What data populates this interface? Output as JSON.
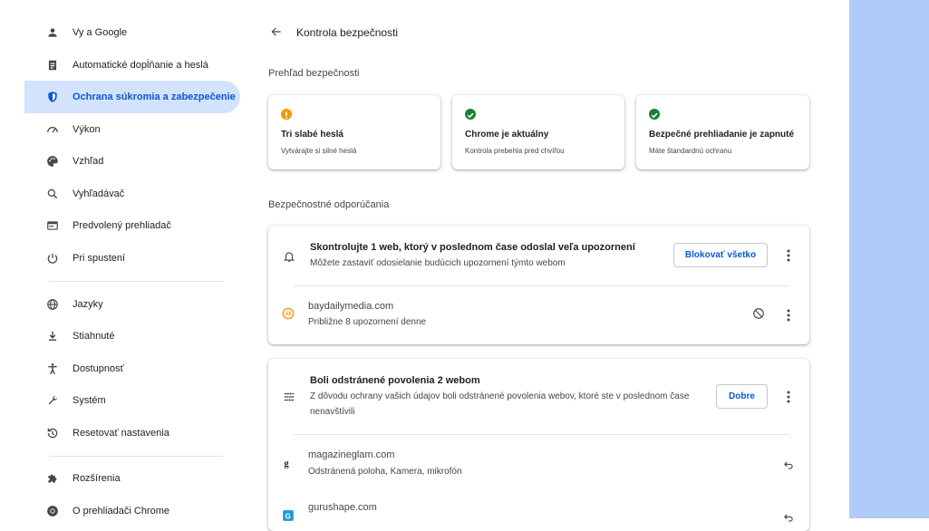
{
  "sidebar": {
    "items": [
      {
        "label": "Vy a Google",
        "icon": "person-icon"
      },
      {
        "label": "Automatické dopĺňanie a heslá",
        "icon": "clipboard-icon"
      },
      {
        "label": "Ochrana súkromia a zabezpečenie",
        "icon": "shield-icon",
        "active": true
      },
      {
        "label": "Výkon",
        "icon": "speedometer-icon"
      },
      {
        "label": "Vzhľad",
        "icon": "palette-icon"
      },
      {
        "label": "Vyhľadávač",
        "icon": "search-icon"
      },
      {
        "label": "Predvolený prehliadač",
        "icon": "browser-icon"
      },
      {
        "label": "Pri spustení",
        "icon": "power-icon"
      },
      {
        "label": "Jazyky",
        "icon": "globe-icon"
      },
      {
        "label": "Stiahnuté",
        "icon": "download-icon"
      },
      {
        "label": "Dostupnosť",
        "icon": "accessibility-icon"
      },
      {
        "label": "Systém",
        "icon": "wrench-icon"
      },
      {
        "label": "Resetovať nastavenia",
        "icon": "history-icon"
      },
      {
        "label": "Rozšírenia",
        "icon": "puzzle-icon"
      },
      {
        "label": "O prehliadači Chrome",
        "icon": "chrome-icon"
      }
    ]
  },
  "header": {
    "title": "Kontrola bezpečnosti"
  },
  "overview": {
    "title": "Prehľad bezpečnosti",
    "tiles": [
      {
        "title": "Tri slabé heslá",
        "subtitle": "Vytvárajte si silné heslá",
        "status": "warning",
        "color": "#f29900"
      },
      {
        "title": "Chrome je aktuálny",
        "subtitle": "Kontrola prebehla pred chvíľou",
        "status": "ok",
        "color": "#188038"
      },
      {
        "title": "Bezpečné prehliadanie je zapnuté",
        "subtitle": "Máte štandardnú ochranu",
        "status": "ok",
        "color": "#188038"
      }
    ]
  },
  "recommendations": {
    "title": "Bezpečnostné odporúčania",
    "notifications_card": {
      "title": "Skontrolujte 1 web, ktorý v poslednom čase odoslal veľa upozornení",
      "subtitle": "Môžete zastaviť odosielanie budúcich upozornení týmto webom",
      "button": "Blokovať všetko",
      "sites": [
        {
          "name": "baydailymedia.com",
          "detail": "Približne 8 upozornení denne"
        }
      ]
    },
    "permissions_card": {
      "title": "Boli odstránené povolenia 2 webom",
      "subtitle": "Z dôvodu ochrany vašich údajov boli odstránené povolenia webov, ktoré ste v poslednom čase nenavštívili",
      "button": "Dobre",
      "sites": [
        {
          "name": "magazineglam.com",
          "detail": "Odstránená poloha, Kamera, mikrofón"
        },
        {
          "name": "gurushape.com",
          "detail": ""
        }
      ]
    }
  },
  "colors": {
    "accent": "#0b57d0",
    "active_bg": "#d3e3fd",
    "side_panel": "#aecbfa"
  }
}
